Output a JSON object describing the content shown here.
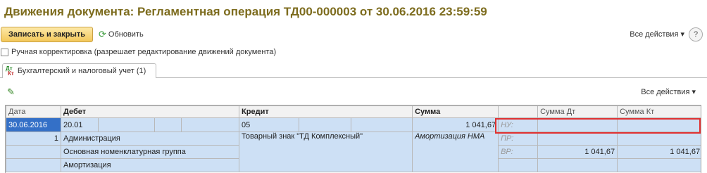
{
  "title": "Движения документа: Регламентная операция ТД00-000003 от 30.06.2016 23:59:59",
  "toolbar": {
    "save_close": "Записать и закрыть",
    "refresh": "Обновить",
    "all_actions": "Все действия ▾",
    "help": "?"
  },
  "manual_correction": {
    "label": "Ручная корректировка (разрешает редактирование движений документа)",
    "checked": false
  },
  "tab": {
    "icon_top": "Дт",
    "icon_bottom": "Кт",
    "label": "Бухгалтерский и налоговый учет (1)"
  },
  "table_toolbar": {
    "all_actions": "Все действия ▾"
  },
  "columns": {
    "date": "Дата",
    "debit": "Дебет",
    "credit": "Кредит",
    "sum": "Сумма",
    "sum_dt": "Сумма Дт",
    "sum_kt": "Сумма Кт"
  },
  "row": {
    "date": "30.06.2016",
    "number": "1",
    "debit_account": "20.01",
    "debit_sub1": "Администрация",
    "debit_sub2": "Основная номенклатурная группа",
    "debit_sub3": "Амортизация",
    "credit_account": "05",
    "credit_sub1": "Товарный знак \"ТД Комплексный\"",
    "sum": "1 041,67",
    "content": "Амортизация НМА",
    "nu": "НУ:",
    "pr": "ПР:",
    "vr": "ВР:",
    "vr_dt": "1 041,67",
    "vr_kt": "1 041,67"
  },
  "colors": {
    "title": "#7d6c1e",
    "selection": "#3470c7",
    "row_bg": "#cde0f5",
    "highlight": "#e03131"
  }
}
